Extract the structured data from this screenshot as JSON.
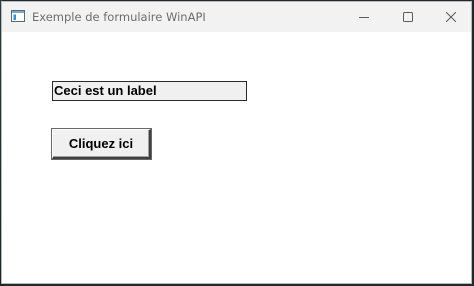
{
  "window": {
    "title": "Exemple de formulaire WinAPI",
    "app_icon": "window-app-icon",
    "caption_buttons": {
      "minimize_icon": "minimize-icon",
      "maximize_icon": "maximize-icon",
      "close_icon": "close-icon"
    }
  },
  "form": {
    "label_text": "Ceci est un label",
    "button_label": "Cliquez ici"
  },
  "colors": {
    "titlebar_bg": "#f2f2f2",
    "client_bg": "#ffffff",
    "control_face": "#f0f0f0",
    "title_text": "#6d6d6d"
  }
}
